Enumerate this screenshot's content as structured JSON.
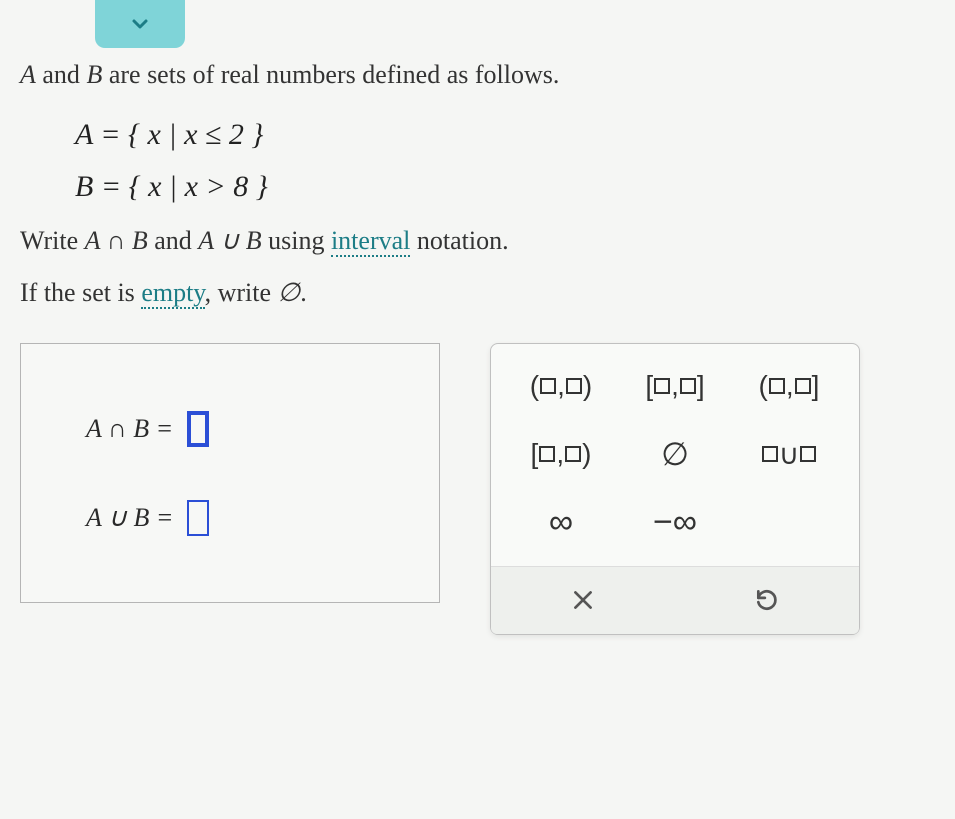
{
  "problem": {
    "intro_prefix": "A",
    "intro_mid": " and ",
    "intro_var2": "B",
    "intro_suffix": " are sets of real numbers defined as follows.",
    "setA": "A = { x | x ≤ 2 }",
    "setB": "B = { x | x > 8 }",
    "instr1_pre": "Write ",
    "instr1_expr1": "A ∩ B",
    "instr1_mid": " and ",
    "instr1_expr2": "A ∪ B",
    "instr1_post": " using ",
    "link_interval": "interval",
    "instr1_end": " notation.",
    "instr2_pre": "If the set is ",
    "link_empty": "empty",
    "instr2_mid": ", write ",
    "emptyset": "∅",
    "instr2_end": "."
  },
  "answers": {
    "line1_label": "A ∩ B  =",
    "line2_label": "A ∪ B  ="
  },
  "palette": {
    "open_open": "(□,□)",
    "closed_closed": "[□,□]",
    "open_closed": "(□,□]",
    "closed_open": "[□,□)",
    "emptyset": "∅",
    "union": "□∪□",
    "infinity": "∞",
    "neg_infinity": "−∞",
    "clear": "×",
    "reset": "↺"
  }
}
